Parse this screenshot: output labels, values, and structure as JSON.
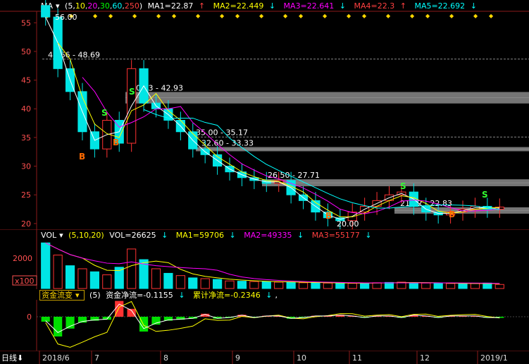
{
  "main_header": {
    "ma_menu": "MA",
    "params_open": "(5,",
    "params": [
      "10",
      "20",
      "30",
      "60",
      "250"
    ],
    "params_close": ")",
    "ma1": "MA1=22.87",
    "ma2": "MA2=22.449",
    "ma3": "MA3=22.641",
    "ma4": "MA4=22.3",
    "ma5": "MA5=22.692",
    "arrows": [
      "↑",
      "↓",
      "↓",
      "↑",
      "↓"
    ]
  },
  "price_axis": [
    "55",
    "50",
    "45",
    "40",
    "35",
    "30",
    "25",
    "20"
  ],
  "annotations": {
    "high": "56.00",
    "low": "20.00",
    "zones": [
      "48.66 - 48.69",
      "40.93 - 42.93",
      "35.00 - 35.17",
      "32.60 - 33.33",
      "26.50 - 27.71",
      "21.72 - 22.83"
    ]
  },
  "signals": {
    "buy": "B",
    "sell": "S"
  },
  "vol_header": {
    "menu": "VOL",
    "params": "(5,10,20)",
    "vol": "VOL=26625",
    "ma1": "MA1=59706",
    "ma2": "MA2=49335",
    "ma3": "MA3=55177",
    "arrows": [
      "↓",
      "↓",
      "↓",
      "↓"
    ]
  },
  "vol_axis": {
    "tick": "2000",
    "unit": "x100"
  },
  "flow_header": {
    "selector": "资金流变",
    "params": "(5)",
    "net": "资金净流=-0.1155",
    "cum": "累计净流=-0.2346",
    "arrows": [
      "↓",
      "↓"
    ],
    "trail": ","
  },
  "flow_axis": {
    "zero": "0"
  },
  "date_axis": {
    "period_button": "日线",
    "labels": [
      "2018/6",
      "7",
      "8",
      "9",
      "10",
      "11",
      "12",
      "2019/1"
    ]
  },
  "colors": {
    "ma5": "#ffffff",
    "ma10": "#ffff00",
    "ma20": "#ff00ff",
    "ma30": "#00ff00",
    "ma60": "#00ffff",
    "up": "#ff3232",
    "down": "#00e5e5",
    "grid": "#8b1a1a"
  },
  "chart_data": [
    {
      "type": "candlestick",
      "title": "MA (5,10,20,30,60,250)",
      "ylim": [
        20,
        56
      ],
      "x": [
        "2018/6",
        "7",
        "8",
        "9",
        "10",
        "11",
        "12",
        "2019/1"
      ],
      "close": [
        56,
        47,
        43,
        36,
        33,
        38,
        34,
        47,
        41,
        40,
        38,
        36,
        33,
        32,
        30,
        29,
        28,
        27.5,
        27,
        27.5,
        25,
        24,
        22,
        21,
        20.5,
        22,
        23,
        24,
        25,
        25.5,
        23,
        22,
        21.5,
        22,
        22.5,
        23,
        22.5,
        22.87
      ],
      "zones": [
        [
          48.66,
          48.69
        ],
        [
          40.93,
          42.93
        ],
        [
          35.0,
          35.17
        ],
        [
          32.6,
          33.33
        ],
        [
          26.5,
          27.71
        ],
        [
          21.72,
          22.83
        ]
      ],
      "high": 56.0,
      "low": 20.0
    },
    {
      "type": "bar",
      "title": "VOL (5,10,20)",
      "values": [
        3000,
        2200,
        1500,
        1300,
        1100,
        900,
        1400,
        2600,
        1900,
        1300,
        1000,
        850,
        700,
        650,
        600,
        500,
        480,
        460,
        450,
        420,
        400,
        380,
        380,
        360,
        350,
        340,
        360,
        380,
        400,
        420,
        380,
        360,
        340,
        330,
        320,
        340,
        360,
        266
      ]
    },
    {
      "type": "bar",
      "title": "资金流变 (5)",
      "values": [
        -0.5,
        -2.0,
        -1.2,
        -0.6,
        -0.4,
        -0.3,
        1.6,
        0.8,
        -1.5,
        -0.8,
        -0.4,
        -0.3,
        -0.2,
        0.3,
        -0.2,
        -0.1,
        0.2,
        -0.1,
        0.1,
        0.1,
        -0.2,
        -0.1,
        0.1,
        0.1,
        0.2,
        0.1,
        -0.1,
        0.1,
        0.1,
        -0.1,
        0.2,
        0.1,
        -0.1,
        0.1,
        0.1,
        0.1,
        -0.1,
        -0.1155
      ]
    }
  ]
}
